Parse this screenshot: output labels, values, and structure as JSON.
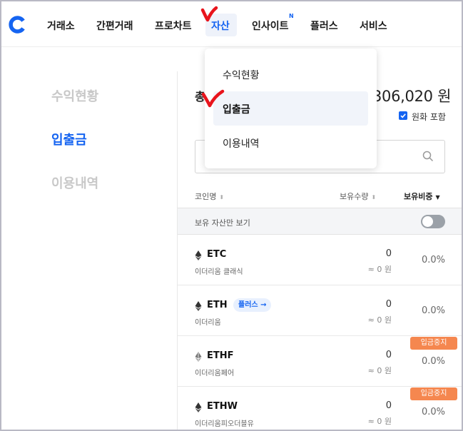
{
  "nav": {
    "items": [
      "거래소",
      "간편거래",
      "프로차트",
      "자산",
      "인사이트",
      "플러스",
      "서비스"
    ],
    "new_badge": "N"
  },
  "dropdown": {
    "items": [
      "수익현황",
      "입출금",
      "이용내역"
    ]
  },
  "sidebar": {
    "items": [
      "수익현황",
      "입출금",
      "이용내역"
    ]
  },
  "summary": {
    "title_partial": "총",
    "amount_partial": "306,020 원",
    "krw_include_label": "원화 포함"
  },
  "table": {
    "headers": {
      "coin": "코인명",
      "qty": "보유수량",
      "weight": "보유비중"
    },
    "filter_label": "보유 자산만 보기"
  },
  "coins": [
    {
      "symbol": "ETC",
      "name": "이더리움 클래식",
      "qty": "0",
      "krw": "≈ 0 원",
      "pct": "0.0%",
      "badge": "",
      "suspend": ""
    },
    {
      "symbol": "ETH",
      "name": "이더리움",
      "qty": "0",
      "krw": "≈ 0 원",
      "pct": "0.0%",
      "badge": "플러스 →",
      "suspend": ""
    },
    {
      "symbol": "ETHF",
      "name": "이더리움페어",
      "qty": "0",
      "krw": "≈ 0 원",
      "pct": "0.0%",
      "badge": "",
      "suspend": "입금중지"
    },
    {
      "symbol": "ETHW",
      "name": "이더리움피오더블유",
      "qty": "0",
      "krw": "≈ 0 원",
      "pct": "0.0%",
      "badge": "",
      "suspend": "입금중지"
    }
  ],
  "colors": {
    "accent": "#1564f1",
    "suspend": "#f5874f",
    "annotation": "#e8141c"
  }
}
